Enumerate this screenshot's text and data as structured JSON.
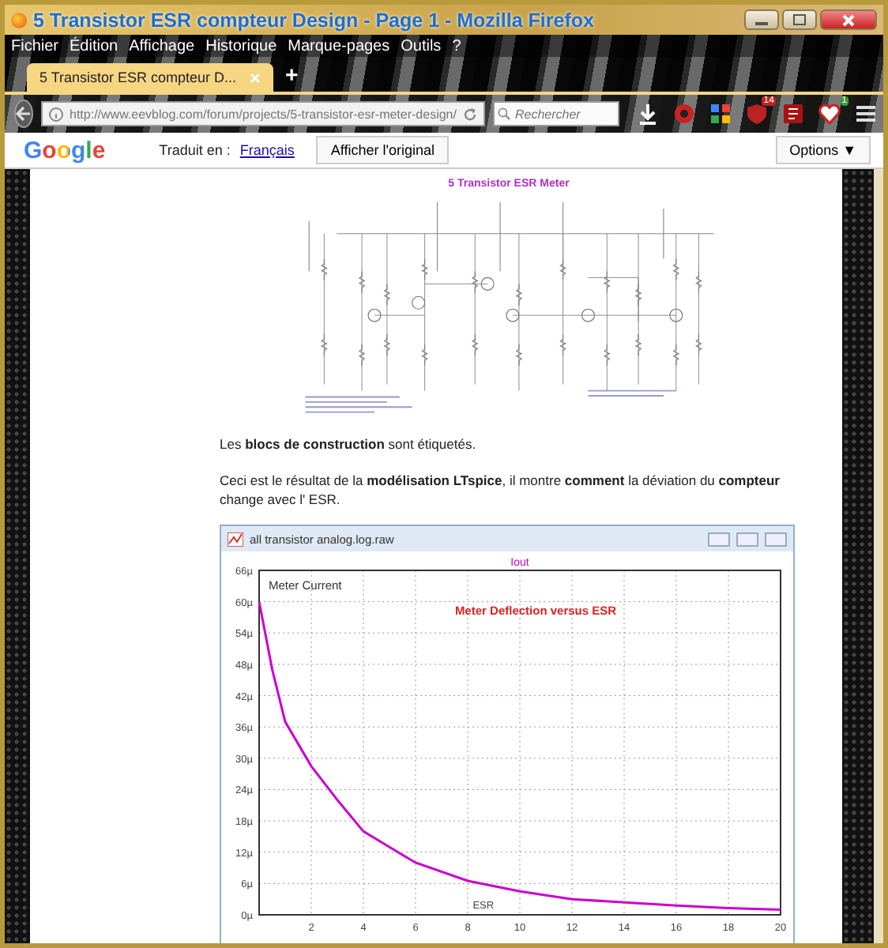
{
  "window": {
    "title": "5 Transistor ESR compteur Design - Page 1 - Mozilla Firefox"
  },
  "menu": [
    "Fichier",
    "Édition",
    "Affichage",
    "Historique",
    "Marque-pages",
    "Outils",
    "?"
  ],
  "tabs": [
    {
      "label": "5 Transistor ESR compteur D...",
      "selected": true
    }
  ],
  "new_tab": "+",
  "address_bar": {
    "url": "http://www.eevblog.com/forum/projects/5-transistor-esr-meter-design/"
  },
  "search": {
    "placeholder": "Rechercher"
  },
  "toolbar_icons": [
    {
      "kind": "download"
    },
    {
      "kind": "record"
    },
    {
      "kind": "apps"
    },
    {
      "kind": "shield",
      "badge": "14"
    },
    {
      "kind": "square"
    },
    {
      "kind": "heart",
      "badge": "1"
    },
    {
      "kind": "menu"
    }
  ],
  "translate_bar": {
    "logo": "Google",
    "label": "Traduit en :",
    "language": "Français",
    "show_original": "Afficher l'original",
    "options": "Options ▼"
  },
  "article": {
    "figure_title": "5 Transistor ESR Meter",
    "paragraphs": [
      "Les **blocs de construction** sont étiquetés.",
      "Ceci est le résultat de la **modélisation LTspice**, il montre **comment** la déviation du **compteur** change avec l' ESR."
    ],
    "plot_window": {
      "title": "all transistor analog.log.raw",
      "chart_data": {
        "type": "line",
        "xlabel": "ESR",
        "x": [
          0,
          0.5,
          1,
          2,
          3,
          4,
          5,
          6,
          8,
          10,
          12,
          14,
          16,
          18,
          20
        ],
        "series": [
          {
            "name": "Iout",
            "color": "#cc00cc",
            "values": [
              60,
              47,
              37,
              28.5,
              22,
              16,
              13,
              10,
              6.5,
              4.5,
              3,
              2.4,
              1.8,
              1.3,
              1
            ]
          }
        ],
        "grid": true,
        "xlim": [
          0,
          20
        ],
        "ylim": [
          0,
          66
        ],
        "xticks": [
          2,
          4,
          6,
          8,
          10,
          12,
          14,
          16,
          18,
          20
        ],
        "yticks": [
          {
            "value": 0,
            "label": "0µ"
          },
          {
            "value": 6,
            "label": "6µ"
          },
          {
            "value": 12,
            "label": "12µ"
          },
          {
            "value": 18,
            "label": "18µ"
          },
          {
            "value": 24,
            "label": "24µ"
          },
          {
            "value": 30,
            "label": "30µ"
          },
          {
            "value": 36,
            "label": "36µ"
          },
          {
            "value": 42,
            "label": "42µ"
          },
          {
            "value": 48,
            "label": "48µ"
          },
          {
            "value": 54,
            "label": "54µ"
          },
          {
            "value": 60,
            "label": "60µ"
          },
          {
            "value": 66,
            "label": "66µ"
          }
        ],
        "annotations": [
          {
            "text": "Meter Current"
          },
          {
            "text": "Meter Deflection versus ESR"
          }
        ]
      }
    }
  }
}
